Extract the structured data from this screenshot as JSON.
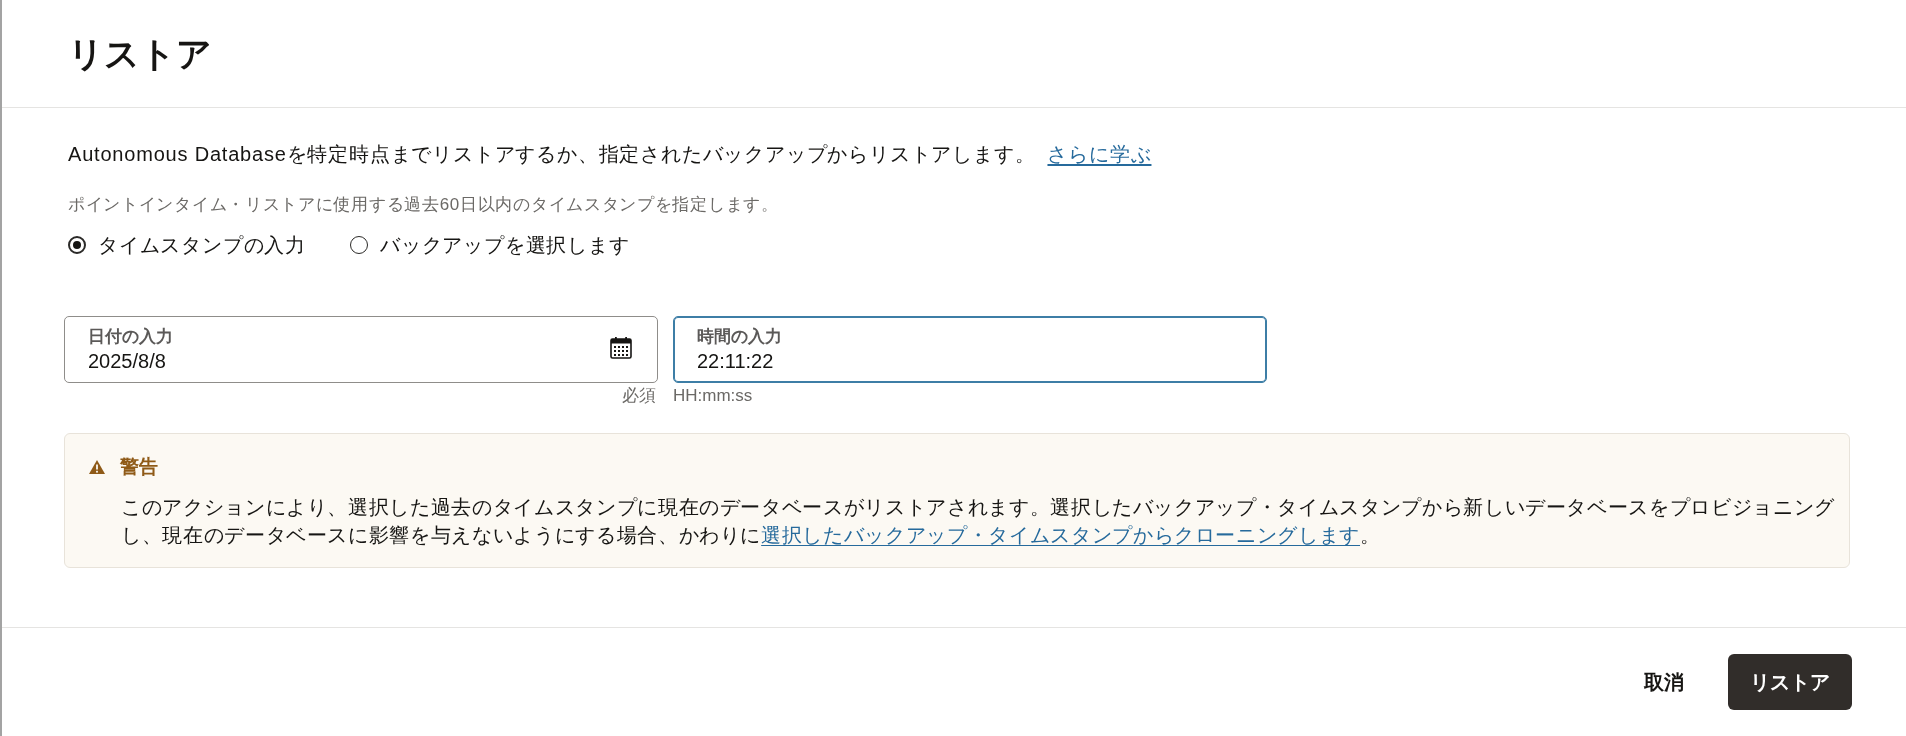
{
  "dialog": {
    "title": "リストア"
  },
  "description": {
    "text": "Autonomous Databaseを特定時点までリストアするか、指定されたバックアップからリストアします。",
    "link": "さらに学ぶ"
  },
  "hint": "ポイントインタイム・リストアに使用する過去60日以内のタイムスタンプを指定します。",
  "restore_options": [
    {
      "label": "タイムスタンプの入力",
      "selected": true
    },
    {
      "label": "バックアップを選択します",
      "selected": false
    }
  ],
  "fields": [
    {
      "kind": "date",
      "label": "日付の入力",
      "value": "2025/8/8",
      "focused": false,
      "required_note": "必須"
    },
    {
      "kind": "time",
      "label": "時間の入力",
      "value": "22:11:22",
      "focused": true,
      "helper": "HH:mm:ss"
    }
  ],
  "warning": {
    "title": "警告",
    "text": "このアクションにより、選択した過去のタイムスタンプに現在のデータベースがリストアされます。選択したバックアップ・タイムスタンプから新しいデータベースをプロビジョニングし、現在のデータベースに影響を与えないようにする場合、かわりに",
    "link": "選択したバックアップ・タイムスタンプからクローニングします",
    "after": "。"
  },
  "buttons": [
    {
      "label": "取消",
      "kind": "secondary"
    },
    {
      "label": "リストア",
      "kind": "primary"
    }
  ]
}
